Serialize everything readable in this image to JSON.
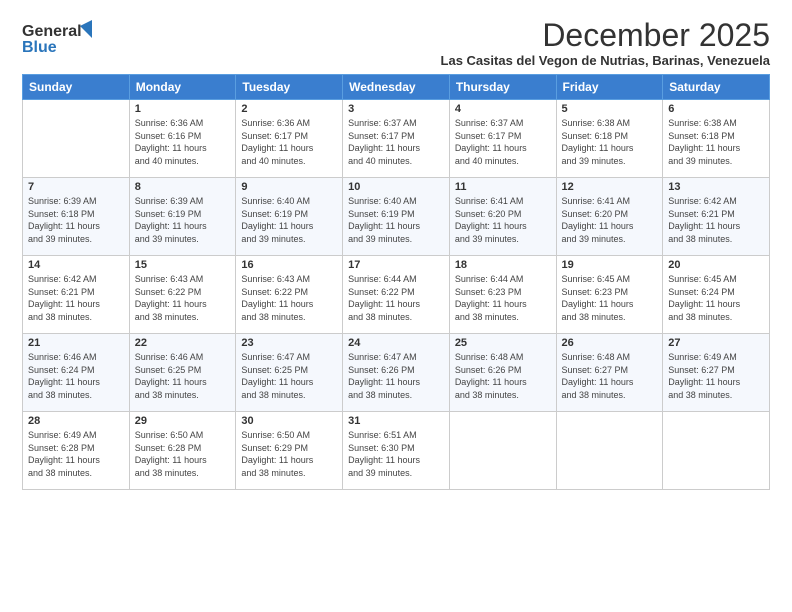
{
  "logo": {
    "line1": "General",
    "line2": "Blue"
  },
  "title": "December 2025",
  "subtitle": "Las Casitas del Vegon de Nutrias, Barinas, Venezuela",
  "days": [
    "Sunday",
    "Monday",
    "Tuesday",
    "Wednesday",
    "Thursday",
    "Friday",
    "Saturday"
  ],
  "weeks": [
    [
      {
        "day": "",
        "info": ""
      },
      {
        "day": "1",
        "info": "Sunrise: 6:36 AM\nSunset: 6:16 PM\nDaylight: 11 hours\nand 40 minutes."
      },
      {
        "day": "2",
        "info": "Sunrise: 6:36 AM\nSunset: 6:17 PM\nDaylight: 11 hours\nand 40 minutes."
      },
      {
        "day": "3",
        "info": "Sunrise: 6:37 AM\nSunset: 6:17 PM\nDaylight: 11 hours\nand 40 minutes."
      },
      {
        "day": "4",
        "info": "Sunrise: 6:37 AM\nSunset: 6:17 PM\nDaylight: 11 hours\nand 40 minutes."
      },
      {
        "day": "5",
        "info": "Sunrise: 6:38 AM\nSunset: 6:18 PM\nDaylight: 11 hours\nand 39 minutes."
      },
      {
        "day": "6",
        "info": "Sunrise: 6:38 AM\nSunset: 6:18 PM\nDaylight: 11 hours\nand 39 minutes."
      }
    ],
    [
      {
        "day": "7",
        "info": "Sunrise: 6:39 AM\nSunset: 6:18 PM\nDaylight: 11 hours\nand 39 minutes."
      },
      {
        "day": "8",
        "info": "Sunrise: 6:39 AM\nSunset: 6:19 PM\nDaylight: 11 hours\nand 39 minutes."
      },
      {
        "day": "9",
        "info": "Sunrise: 6:40 AM\nSunset: 6:19 PM\nDaylight: 11 hours\nand 39 minutes."
      },
      {
        "day": "10",
        "info": "Sunrise: 6:40 AM\nSunset: 6:19 PM\nDaylight: 11 hours\nand 39 minutes."
      },
      {
        "day": "11",
        "info": "Sunrise: 6:41 AM\nSunset: 6:20 PM\nDaylight: 11 hours\nand 39 minutes."
      },
      {
        "day": "12",
        "info": "Sunrise: 6:41 AM\nSunset: 6:20 PM\nDaylight: 11 hours\nand 39 minutes."
      },
      {
        "day": "13",
        "info": "Sunrise: 6:42 AM\nSunset: 6:21 PM\nDaylight: 11 hours\nand 38 minutes."
      }
    ],
    [
      {
        "day": "14",
        "info": "Sunrise: 6:42 AM\nSunset: 6:21 PM\nDaylight: 11 hours\nand 38 minutes."
      },
      {
        "day": "15",
        "info": "Sunrise: 6:43 AM\nSunset: 6:22 PM\nDaylight: 11 hours\nand 38 minutes."
      },
      {
        "day": "16",
        "info": "Sunrise: 6:43 AM\nSunset: 6:22 PM\nDaylight: 11 hours\nand 38 minutes."
      },
      {
        "day": "17",
        "info": "Sunrise: 6:44 AM\nSunset: 6:22 PM\nDaylight: 11 hours\nand 38 minutes."
      },
      {
        "day": "18",
        "info": "Sunrise: 6:44 AM\nSunset: 6:23 PM\nDaylight: 11 hours\nand 38 minutes."
      },
      {
        "day": "19",
        "info": "Sunrise: 6:45 AM\nSunset: 6:23 PM\nDaylight: 11 hours\nand 38 minutes."
      },
      {
        "day": "20",
        "info": "Sunrise: 6:45 AM\nSunset: 6:24 PM\nDaylight: 11 hours\nand 38 minutes."
      }
    ],
    [
      {
        "day": "21",
        "info": "Sunrise: 6:46 AM\nSunset: 6:24 PM\nDaylight: 11 hours\nand 38 minutes."
      },
      {
        "day": "22",
        "info": "Sunrise: 6:46 AM\nSunset: 6:25 PM\nDaylight: 11 hours\nand 38 minutes."
      },
      {
        "day": "23",
        "info": "Sunrise: 6:47 AM\nSunset: 6:25 PM\nDaylight: 11 hours\nand 38 minutes."
      },
      {
        "day": "24",
        "info": "Sunrise: 6:47 AM\nSunset: 6:26 PM\nDaylight: 11 hours\nand 38 minutes."
      },
      {
        "day": "25",
        "info": "Sunrise: 6:48 AM\nSunset: 6:26 PM\nDaylight: 11 hours\nand 38 minutes."
      },
      {
        "day": "26",
        "info": "Sunrise: 6:48 AM\nSunset: 6:27 PM\nDaylight: 11 hours\nand 38 minutes."
      },
      {
        "day": "27",
        "info": "Sunrise: 6:49 AM\nSunset: 6:27 PM\nDaylight: 11 hours\nand 38 minutes."
      }
    ],
    [
      {
        "day": "28",
        "info": "Sunrise: 6:49 AM\nSunset: 6:28 PM\nDaylight: 11 hours\nand 38 minutes."
      },
      {
        "day": "29",
        "info": "Sunrise: 6:50 AM\nSunset: 6:28 PM\nDaylight: 11 hours\nand 38 minutes."
      },
      {
        "day": "30",
        "info": "Sunrise: 6:50 AM\nSunset: 6:29 PM\nDaylight: 11 hours\nand 38 minutes."
      },
      {
        "day": "31",
        "info": "Sunrise: 6:51 AM\nSunset: 6:30 PM\nDaylight: 11 hours\nand 39 minutes."
      },
      {
        "day": "",
        "info": ""
      },
      {
        "day": "",
        "info": ""
      },
      {
        "day": "",
        "info": ""
      }
    ]
  ]
}
